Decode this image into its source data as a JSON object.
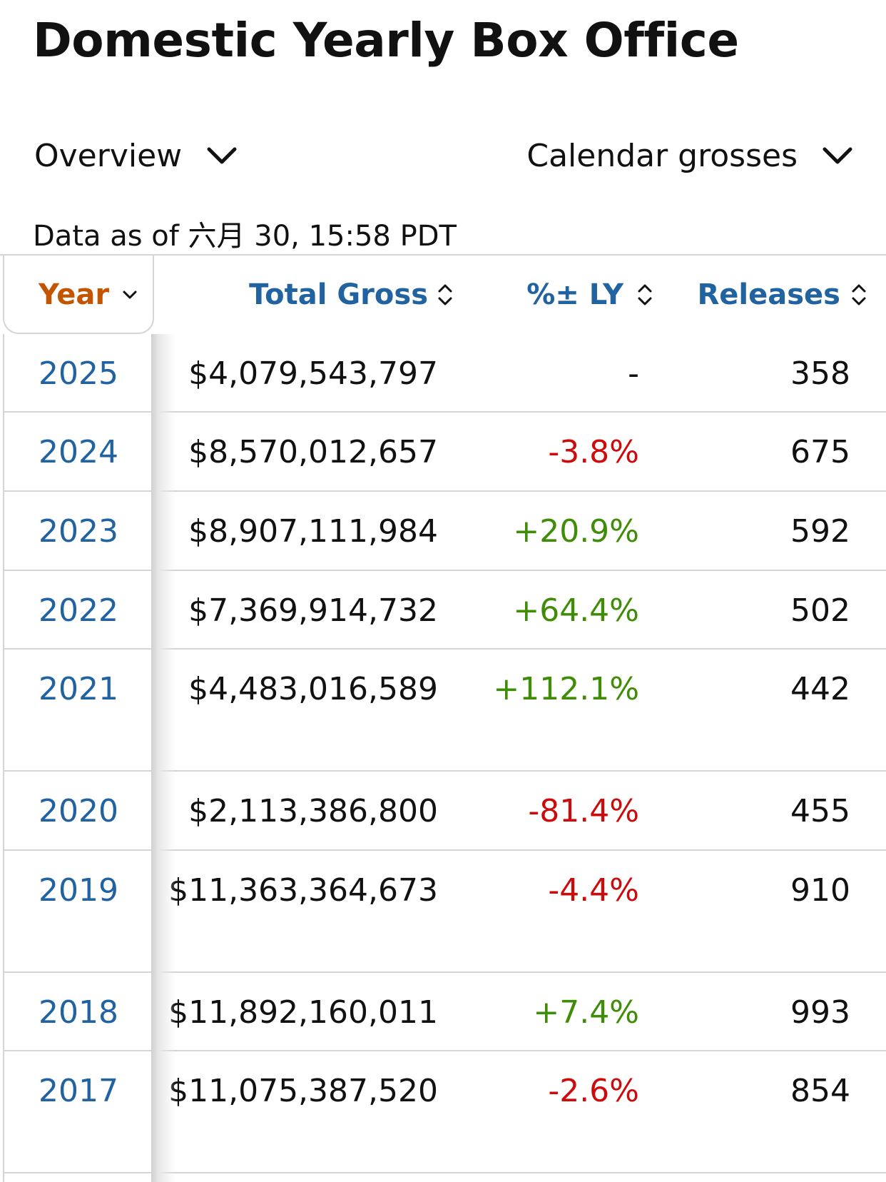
{
  "page": {
    "title": "Domestic Yearly Box Office"
  },
  "filters": {
    "view": {
      "selected": "Overview",
      "icon": "chevron-down-icon"
    },
    "grosses": {
      "selected": "Calendar grosses",
      "icon": "chevron-down-icon"
    }
  },
  "data_as_of": "Data as of 六月 30, 15:58 PDT",
  "table": {
    "columns": {
      "year": "Year",
      "total_gross": "Total Gross",
      "pct_ly": "%± LY",
      "releases": "Releases"
    },
    "rows": [
      {
        "year": "2025",
        "total_gross": "$4,079,543,797",
        "pct_ly": "-",
        "trend": "neutral",
        "releases": "358"
      },
      {
        "year": "2024",
        "total_gross": "$8,570,012,657",
        "pct_ly": "-3.8%",
        "trend": "neg",
        "releases": "675"
      },
      {
        "year": "2023",
        "total_gross": "$8,907,111,984",
        "pct_ly": "+20.9%",
        "trend": "pos",
        "releases": "592"
      },
      {
        "year": "2022",
        "total_gross": "$7,369,914,732",
        "pct_ly": "+64.4%",
        "trend": "pos",
        "releases": "502"
      },
      {
        "year": "2021",
        "total_gross": "$4,483,016,589",
        "pct_ly": "+112.1%",
        "trend": "pos",
        "releases": "442"
      },
      {
        "year": "2020",
        "total_gross": "$2,113,386,800",
        "pct_ly": "-81.4%",
        "trend": "neg",
        "releases": "455"
      },
      {
        "year": "2019",
        "total_gross": "$11,363,364,673",
        "pct_ly": "-4.4%",
        "trend": "neg",
        "releases": "910"
      },
      {
        "year": "2018",
        "total_gross": "$11,892,160,011",
        "pct_ly": "+7.4%",
        "trend": "pos",
        "releases": "993"
      },
      {
        "year": "2017",
        "total_gross": "$11,075,387,520",
        "pct_ly": "-2.6%",
        "trend": "neg",
        "releases": "854"
      }
    ]
  },
  "colors": {
    "link_blue": "#2162a1",
    "active_orange": "#c45500",
    "negative_red": "#cc0c0c",
    "positive_green": "#3f8c06"
  }
}
